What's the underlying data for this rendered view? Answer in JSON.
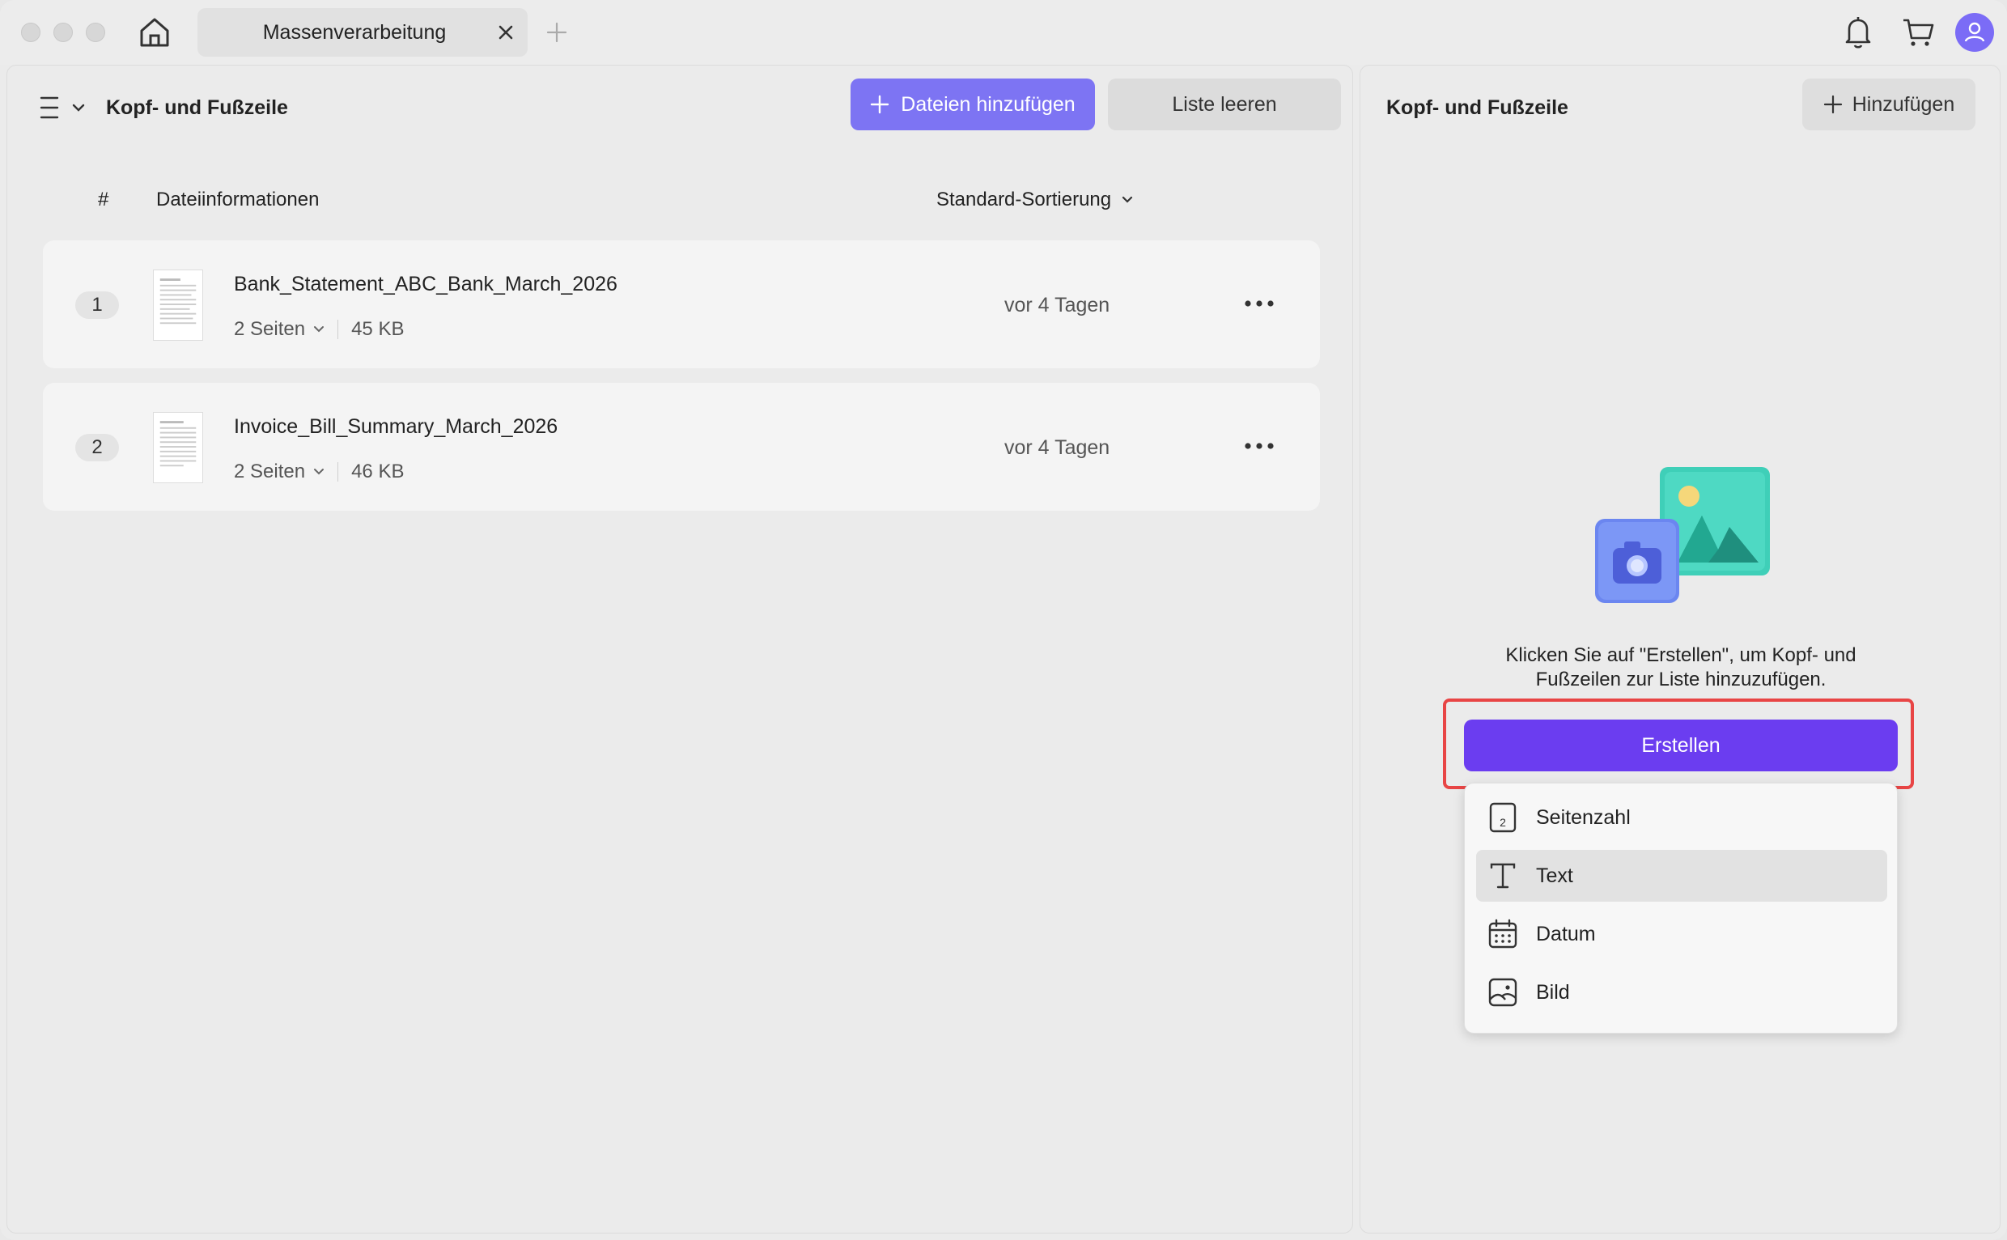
{
  "window": {
    "tab_title": "Massenverarbeitung"
  },
  "left_panel": {
    "title": "Kopf- und Fußzeile",
    "add_files_label": "Dateien hinzufügen",
    "clear_list_label": "Liste leeren",
    "columns": {
      "number": "#",
      "info": "Dateiinformationen",
      "sort": "Standard-Sortierung"
    },
    "files": [
      {
        "index": "1",
        "name": "Bank_Statement_ABC_Bank_March_2026",
        "pages": "2 Seiten",
        "size": "45 KB",
        "date": "vor 4 Tagen"
      },
      {
        "index": "2",
        "name": "Invoice_Bill_Summary_March_2026",
        "pages": "2 Seiten",
        "size": "46 KB",
        "date": "vor 4 Tagen"
      }
    ]
  },
  "right_panel": {
    "title": "Kopf- und Fußzeile",
    "add_label": "Hinzufügen",
    "hint_line1": "Klicken Sie auf \"Erstellen\", um Kopf- und",
    "hint_line2": "Fußzeilen zur Liste hinzuzufügen.",
    "create_label": "Erstellen",
    "menu_items": [
      {
        "label": "Seitenzahl",
        "icon": "page-number-icon"
      },
      {
        "label": "Text",
        "icon": "text-icon"
      },
      {
        "label": "Datum",
        "icon": "calendar-icon"
      },
      {
        "label": "Bild",
        "icon": "image-icon"
      }
    ],
    "active_menu_item": "Text"
  },
  "colors": {
    "primary": "#7d74f3",
    "create": "#6b3df0",
    "highlight": "#e84545"
  }
}
